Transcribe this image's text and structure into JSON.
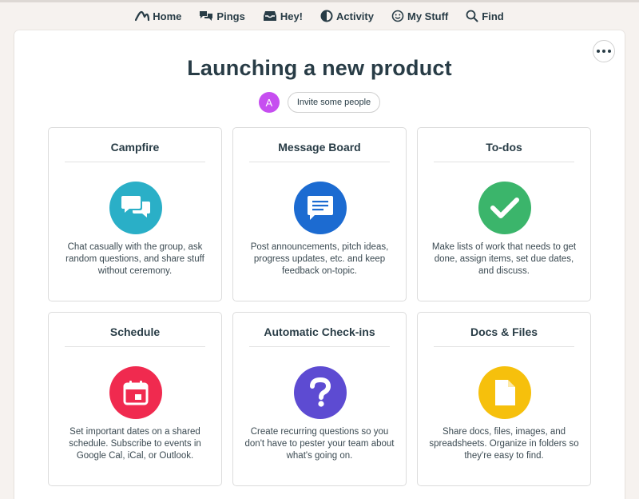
{
  "nav": {
    "items": [
      {
        "label": "Home",
        "icon": "basecamp-mountain-icon"
      },
      {
        "label": "Pings",
        "icon": "chat-bubbles-icon"
      },
      {
        "label": "Hey!",
        "icon": "inbox-tray-icon"
      },
      {
        "label": "Activity",
        "icon": "half-circle-icon"
      },
      {
        "label": "My Stuff",
        "icon": "smiley-face-icon"
      },
      {
        "label": "Find",
        "icon": "magnifier-icon"
      }
    ]
  },
  "project": {
    "title": "Launching a new product",
    "avatar_initial": "A",
    "invite_label": "Invite some people"
  },
  "tools": [
    {
      "title": "Campfire",
      "desc": "Chat casually with the group, ask random questions, and share stuff without ceremony.",
      "icon": "chat-bubbles-icon",
      "color": "#2aafc7"
    },
    {
      "title": "Message Board",
      "desc": "Post announcements, pitch ideas, progress updates, etc. and keep feedback on-topic.",
      "icon": "message-document-icon",
      "color": "#1c6bd1"
    },
    {
      "title": "To-dos",
      "desc": "Make lists of work that needs to get done, assign items, set due dates, and discuss.",
      "icon": "checkmark-icon",
      "color": "#3bb56b"
    },
    {
      "title": "Schedule",
      "desc": "Set important dates on a shared schedule. Subscribe to events in Google Cal, iCal, or Outlook.",
      "icon": "calendar-icon",
      "color": "#f02a4f"
    },
    {
      "title": "Automatic Check-ins",
      "desc": "Create recurring questions so you don't have to pester your team about what's going on.",
      "icon": "question-mark-icon",
      "color": "#5d4bd2"
    },
    {
      "title": "Docs & Files",
      "desc": "Share docs, files, images, and spreadsheets. Organize in folders so they're easy to find.",
      "icon": "document-icon",
      "color": "#f6c00c"
    }
  ]
}
